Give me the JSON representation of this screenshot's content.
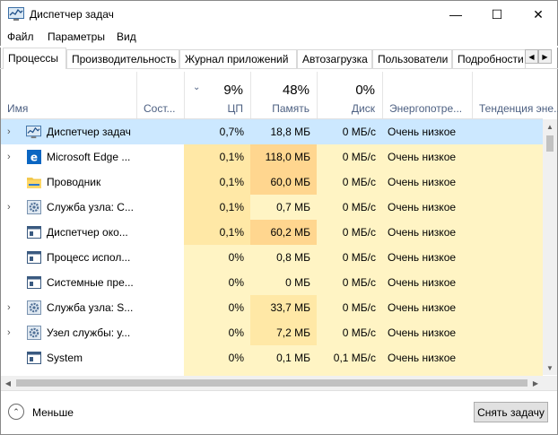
{
  "window": {
    "title": "Диспетчер задач",
    "minimize_glyph": "—",
    "maximize_glyph": "☐",
    "close_glyph": "✕"
  },
  "menu": [
    "Файл",
    "Параметры",
    "Вид"
  ],
  "tabs": [
    "Процессы",
    "Производительность",
    "Журнал приложений",
    "Автозагрузка",
    "Пользователи",
    "Подробности"
  ],
  "tab_scroll": {
    "left": "◀",
    "right": "▶"
  },
  "columns": {
    "name": {
      "label": "Имя"
    },
    "status": {
      "label": "Сост..."
    },
    "cpu": {
      "percent": "9%",
      "label": "ЦП",
      "sort_glyph": "⌄"
    },
    "memory": {
      "percent": "48%",
      "label": "Память"
    },
    "disk": {
      "percent": "0%",
      "label": "Диск"
    },
    "power": {
      "label": "Энергопотре..."
    },
    "trend": {
      "label": "Тенденция эне..."
    }
  },
  "processes": [
    {
      "name": "Диспетчер задач",
      "expand": "›",
      "icon": "task-manager-icon",
      "cpu": "0,7%",
      "memory": "18,8 МБ",
      "disk": "0 МБ/с",
      "power": "Очень низкое",
      "selected": true
    },
    {
      "name": "Microsoft Edge ...",
      "expand": "›",
      "icon": "edge-icon",
      "cpu": "0,1%",
      "memory": "118,0 МБ",
      "disk": "0 МБ/с",
      "power": "Очень низкое"
    },
    {
      "name": "Проводник",
      "expand": "",
      "icon": "folder-icon",
      "cpu": "0,1%",
      "memory": "60,0 МБ",
      "disk": "0 МБ/с",
      "power": "Очень низкое"
    },
    {
      "name": "Служба узла: С...",
      "expand": "›",
      "icon": "gear-icon",
      "cpu": "0,1%",
      "memory": "0,7 МБ",
      "disk": "0 МБ/с",
      "power": "Очень низкое"
    },
    {
      "name": "Диспетчер око...",
      "expand": "",
      "icon": "window-icon",
      "cpu": "0,1%",
      "memory": "60,2 МБ",
      "disk": "0 МБ/с",
      "power": "Очень низкое"
    },
    {
      "name": "Процесс испол...",
      "expand": "",
      "icon": "window-icon",
      "cpu": "0%",
      "memory": "0,8 МБ",
      "disk": "0 МБ/с",
      "power": "Очень низкое"
    },
    {
      "name": "Системные пре...",
      "expand": "",
      "icon": "window-icon",
      "cpu": "0%",
      "memory": "0 МБ",
      "disk": "0 МБ/с",
      "power": "Очень низкое"
    },
    {
      "name": "Служба узла: S...",
      "expand": "›",
      "icon": "gear-icon",
      "cpu": "0%",
      "memory": "33,7 МБ",
      "disk": "0 МБ/с",
      "power": "Очень низкое"
    },
    {
      "name": "Узел службы: у...",
      "expand": "›",
      "icon": "gear-icon",
      "cpu": "0%",
      "memory": "7,2 МБ",
      "disk": "0 МБ/с",
      "power": "Очень низкое"
    },
    {
      "name": "System",
      "expand": "",
      "icon": "window-icon",
      "cpu": "0%",
      "memory": "0,1 МБ",
      "disk": "0,1 МБ/с",
      "power": "Очень низкое"
    },
    {
      "name": "",
      "expand": "",
      "icon": "",
      "cpu": "",
      "memory": "",
      "disk": "",
      "power": ""
    }
  ],
  "footer": {
    "less_label": "Меньше",
    "less_glyph": "⌃",
    "end_task_label": "Снять задачу"
  },
  "colors": {
    "cpu_high": "#ffe8a6",
    "cpu_low": "#fff4c4",
    "mem_high": "#ffd68f",
    "mem_mid": "#ffe8a6",
    "mem_low": "#fff4c4",
    "disk": "#fff4c4",
    "selected": "#cce8ff",
    "accent_blue": "#4d6082"
  }
}
